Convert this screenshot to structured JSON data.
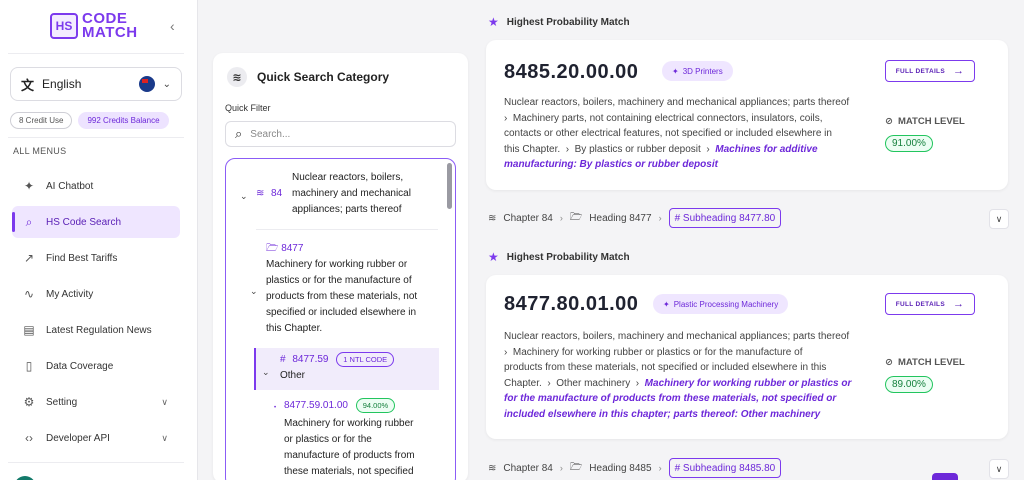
{
  "brand": {
    "logo_mark": "HS",
    "line1": "CODE",
    "line2": "MATCH"
  },
  "language": {
    "label": "English"
  },
  "credits": {
    "use": "8 Credit Use",
    "balance": "992 Credits Balance"
  },
  "menu": {
    "title": "ALL MENUS",
    "items": [
      {
        "label": "AI Chatbot",
        "icon": "sparkle-icon"
      },
      {
        "label": "HS Code Search",
        "icon": "search-icon",
        "active": true
      },
      {
        "label": "Find Best Tariffs",
        "icon": "trend-icon"
      },
      {
        "label": "My Activity",
        "icon": "activity-icon"
      },
      {
        "label": "Latest Regulation News",
        "icon": "news-icon"
      },
      {
        "label": "Data Coverage",
        "icon": "document-icon"
      },
      {
        "label": "Setting",
        "icon": "gear-icon",
        "has_children": true
      },
      {
        "label": "Developer API",
        "icon": "code-icon",
        "has_children": true
      }
    ]
  },
  "quick_search": {
    "title": "Quick Search Category",
    "filter_label": "Quick Filter",
    "search_placeholder": "Search...",
    "tree": {
      "chapter_code": "84",
      "chapter_desc_1": "Nuclear reactors, boilers,",
      "chapter_desc_2": "machinery and mechanical",
      "chapter_desc_3": "appliances; parts thereof",
      "heading_code": "8477",
      "heading_desc": [
        "Machinery for working rubber or",
        "plastics or for the manufacture of",
        "products from these materials, not",
        "specified or included elsewhere in",
        "this Chapter."
      ],
      "subheading_code": "8477.59",
      "subheading_badge": "1 NTL CODE",
      "subheading_desc": "Other",
      "ntl_code": "8477.59.01.00",
      "ntl_pct": "94.00%",
      "ntl_desc": [
        "Machinery for working rubber",
        "or plastics or for the",
        "manufacture of products from",
        "these materials, not specified"
      ]
    }
  },
  "results": [
    {
      "header": "Highest Probability Match",
      "code": "8485.20.00.00",
      "tag": "3D Printers",
      "full_details": "FULL DETAILS",
      "desc_lines": [
        "Nuclear reactors, boilers, machinery and mechanical appliances; parts thereof",
        "Machinery parts, not containing electrical connectors, insulators, coils,",
        "contacts or other electrical features, not specified or included elsewhere in",
        "this Chapter.",
        "By plastics or rubber deposit",
        "Machines for additive",
        "manufacturing: By plastics or rubber deposit"
      ],
      "match_label": "MATCH LEVEL",
      "match_pct": "91.00%",
      "crumb": {
        "chapter": "Chapter 84",
        "heading": "Heading 8477",
        "subheading": "# Subheading 8477.80"
      }
    },
    {
      "header": "Highest Probability Match",
      "code": "8477.80.01.00",
      "tag": "Plastic Processing Machinery",
      "full_details": "FULL DETAILS",
      "desc_lines": [
        "Nuclear reactors, boilers, machinery and mechanical appliances; parts thereof",
        "Machinery for working rubber or plastics or for the manufacture of",
        "products from these materials, not specified or included elsewhere in this",
        "Chapter.",
        "Other machinery",
        "Machinery for working rubber or plastics or",
        "for the manufacture of products from these materials, not specified or",
        "included elsewhere in this chapter; parts thereof: Other machinery"
      ],
      "match_label": "MATCH LEVEL",
      "match_pct": "89.00%",
      "crumb": {
        "chapter": "Chapter 84",
        "heading": "Heading 8485",
        "subheading": "# Subheading 8485.80"
      }
    }
  ]
}
